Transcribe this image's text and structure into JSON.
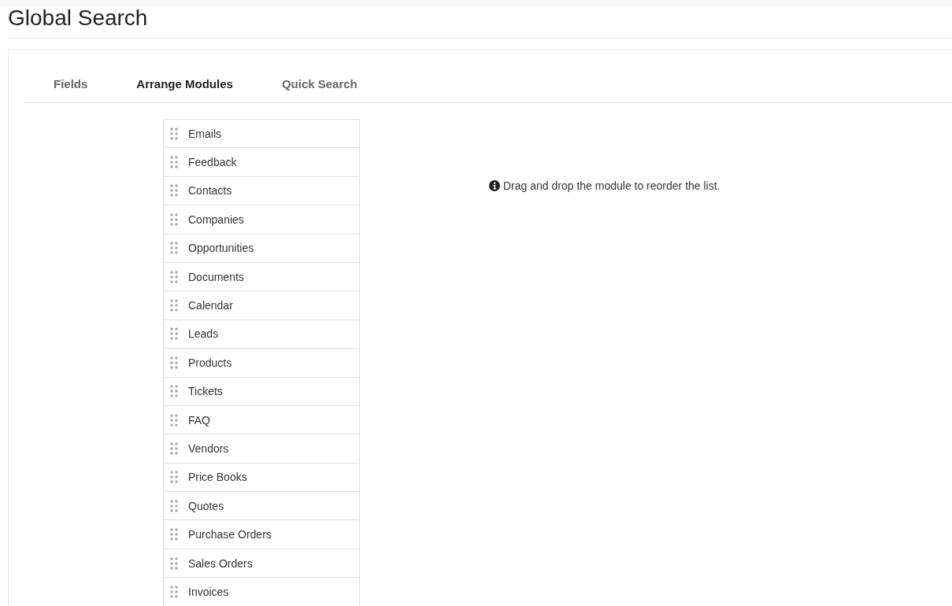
{
  "page": {
    "title": "Global Search"
  },
  "tabs": [
    {
      "label": "Fields",
      "selected": false
    },
    {
      "label": "Arrange Modules",
      "selected": true
    },
    {
      "label": "Quick Search",
      "selected": false
    }
  ],
  "modules": [
    "Emails",
    "Feedback",
    "Contacts",
    "Companies",
    "Opportunities",
    "Documents",
    "Calendar",
    "Leads",
    "Products",
    "Tickets",
    "FAQ",
    "Vendors",
    "Price Books",
    "Quotes",
    "Purchase Orders",
    "Sales Orders",
    "Invoices"
  ],
  "hint": "Drag and drop the module to reorder the list."
}
